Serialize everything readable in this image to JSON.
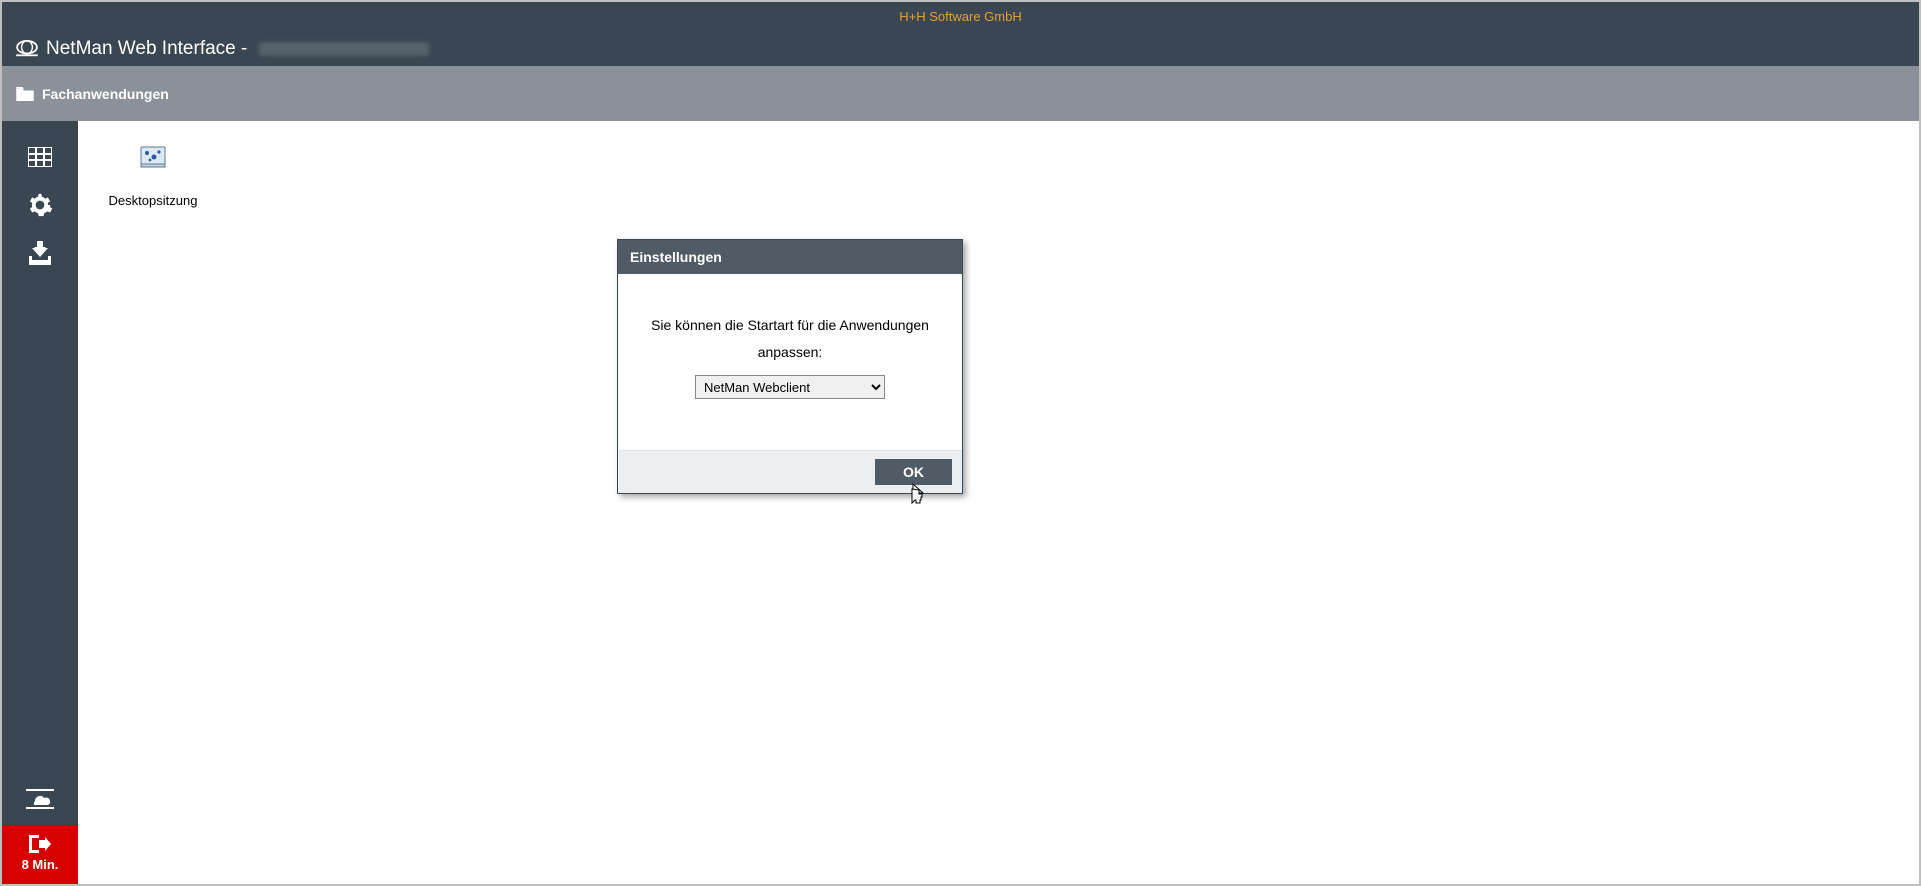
{
  "company": "H+H Software GmbH",
  "app_title": "NetMan Web Interface - ",
  "breadcrumb": {
    "label": "Fachanwendungen"
  },
  "sidebar": {
    "grid_icon": "grid-icon",
    "gear_icon": "gear-icon",
    "download_icon": "download-icon",
    "cloud_icon": "cloud-icon",
    "logout_icon": "logout-icon",
    "logout_label": "8 Min."
  },
  "content": {
    "apps": [
      {
        "label": "Desktopsitzung",
        "icon": "desktop-session-icon"
      }
    ]
  },
  "dialog": {
    "title": "Einstellungen",
    "message_line1": "Sie können die Startart für die Anwendungen",
    "message_line2": "anpassen:",
    "select_value": "NetMan Webclient",
    "ok_label": "OK"
  }
}
